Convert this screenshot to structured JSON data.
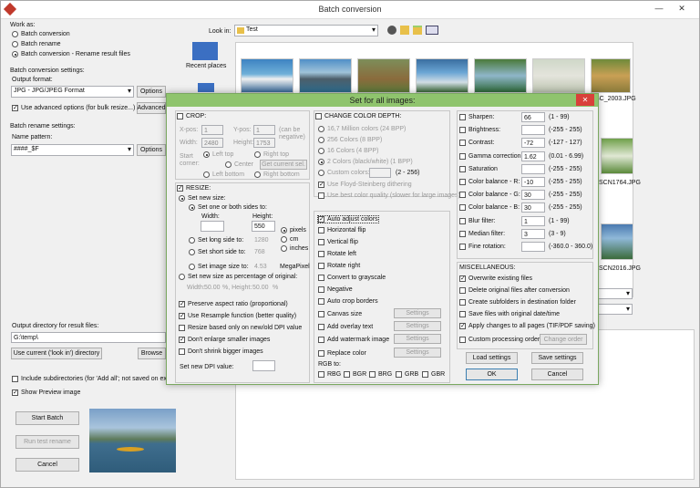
{
  "window": {
    "title": "Batch conversion"
  },
  "left": {
    "work_as": "Work as:",
    "radio_batch_conversion": "Batch conversion",
    "radio_batch_rename": "Batch rename",
    "radio_conv_rename": "Batch conversion - Rename result files",
    "conv_settings": "Batch conversion settings:",
    "output_format": "Output format:",
    "format_value": "JPG - JPG/JPEG Format",
    "options_btn": "Options",
    "use_advanced": "Use advanced options (for bulk resize...)",
    "advanced_btn": "Advanced",
    "rename_settings": "Batch rename settings:",
    "name_pattern": "Name pattern:",
    "pattern_value": "####_$F",
    "options_btn2": "Options",
    "output_dir": "Output directory for result files:",
    "output_value": "G:\\temp\\",
    "use_current_btn": "Use current ('look in') directory",
    "browse_btn": "Browse",
    "include_subdirs": "Include subdirectories (for 'Add all'; not saved on exit)",
    "show_preview": "Show Preview image",
    "start_batch_btn": "Start Batch",
    "run_test_btn": "Run test rename",
    "cancel_btn": "Cancel"
  },
  "browser": {
    "look_in": "Look in:",
    "folder": "Test",
    "recent_places": "Recent places",
    "files": [
      "SC_2003.JPG",
      "SCN1764.JPG",
      "SCN2016.JPG"
    ]
  },
  "dialog": {
    "title": "Set for all images:",
    "crop": {
      "label": "CROP:",
      "xpos_label": "X-pos:",
      "xpos": "1",
      "ypos_label": "Y-pos:",
      "ypos": "1",
      "can_be_negative": "(can be negative)",
      "width_label": "Width:",
      "width": "2480",
      "height_label": "Height:",
      "height": "1753",
      "start_corner": "Start corner:",
      "left_top": "Left top",
      "right_top": "Right top",
      "center": "Center",
      "get_current": "Get current sel.",
      "left_bottom": "Left bottom",
      "right_bottom": "Right bottom"
    },
    "resize": {
      "label": "RESIZE:",
      "set_new_size": "Set new size:",
      "set_sides": "Set one or both sides to:",
      "width_label": "Width:",
      "height_label": "Height:",
      "width_value": "",
      "height_value": "550",
      "pixels": "pixels",
      "cm": "cm",
      "inches": "inches",
      "long_side": "Set long side to:",
      "long_value": "1280",
      "short_side": "Set short side to:",
      "short_value": "768",
      "image_size": "Set image size to:",
      "image_size_value": "4.53",
      "megapixel": "MegaPixel",
      "percentage": "Set new size as percentage of original:",
      "pct_width_label": "Width:",
      "pct_width": "50.00",
      "pct_height_label": "%, Height:",
      "pct_height": "50.00",
      "pct_sign": "%",
      "preserve": "Preserve aspect ratio (proportional)",
      "resample": "Use Resample function (better quality)",
      "dpi_resize": "Resize based only on new/old DPI value",
      "dont_enlarge": "Don't enlarge smaller images",
      "dont_shrink": "Don't shrink bigger images",
      "new_dpi": "Set new DPI value:",
      "dpi_value": ""
    },
    "color_depth": {
      "label": "CHANGE COLOR DEPTH:",
      "opt1": "16,7 Million colors (24 BPP)",
      "opt2": "256 Colors (8 BPP)",
      "opt3": "16 Colors (4 BPP)",
      "opt4": "2 Colors (black/white) (1 BPP)",
      "custom": "Custom colors:",
      "custom_range": "(2 - 256)",
      "floyd": "Use Floyd-Steinberg dithering",
      "best_quality": "Use best color quality (slower for large images)"
    },
    "mid": {
      "auto_adjust": "Auto adjust colors",
      "hflip": "Horizontal flip",
      "vflip": "Vertical flip",
      "rotate_left": "Rotate left",
      "rotate_right": "Rotate right",
      "grayscale": "Convert to grayscale",
      "negative": "Negative",
      "auto_crop": "Auto crop borders",
      "canvas": "Canvas size",
      "overlay_text": "Add overlay text",
      "watermark": "Add watermark image",
      "replace_color": "Replace color",
      "settings": "Settings",
      "rgb_to": "RGB to:",
      "rgb_opts": [
        "RBG",
        "BGR",
        "BRG",
        "GRB",
        "GBR"
      ]
    },
    "adjust": [
      {
        "label": "Sharpen:",
        "value": "66",
        "range": "(1 - 99)",
        "checked": false
      },
      {
        "label": "Brightness:",
        "value": "",
        "range": "(-255 - 255)",
        "checked": false
      },
      {
        "label": "Contrast:",
        "value": "-72",
        "range": "(-127 - 127)",
        "checked": false
      },
      {
        "label": "Gamma correction:",
        "value": "1.62",
        "range": "(0.01 - 6.99)",
        "checked": false
      },
      {
        "label": "Saturation",
        "value": "",
        "range": "(-255 - 255)",
        "checked": false
      },
      {
        "label": "Color balance - R:",
        "value": "-10",
        "range": "(-255 - 255)",
        "checked": false
      },
      {
        "label": "Color balance - G:",
        "value": "30",
        "range": "(-255 - 255)",
        "checked": false
      },
      {
        "label": "Color balance - B:",
        "value": "30",
        "range": "(-255 - 255)",
        "checked": false
      },
      {
        "label": "Blur filter:",
        "value": "1",
        "range": "(1 - 99)",
        "checked": false
      },
      {
        "label": "Median filter:",
        "value": "3",
        "range": "(3 - 9)",
        "checked": false
      },
      {
        "label": "Fine rotation:",
        "value": "",
        "range": "(-360.0 - 360.0)",
        "checked": false
      }
    ],
    "misc": {
      "label": "MISCELLANEOUS:",
      "overwrite": "Overwrite existing files",
      "delete_orig": "Delete original files after conversion",
      "subfolders": "Create subfolders in destination folder",
      "save_date": "Save files with original date/time",
      "apply_pages": "Apply changes to all pages (TIF/PDF saving)",
      "custom_order": "Custom processing order",
      "change_order": "Change order"
    },
    "buttons": {
      "load": "Load settings",
      "save": "Save settings",
      "ok": "OK",
      "cancel": "Cancel"
    }
  }
}
